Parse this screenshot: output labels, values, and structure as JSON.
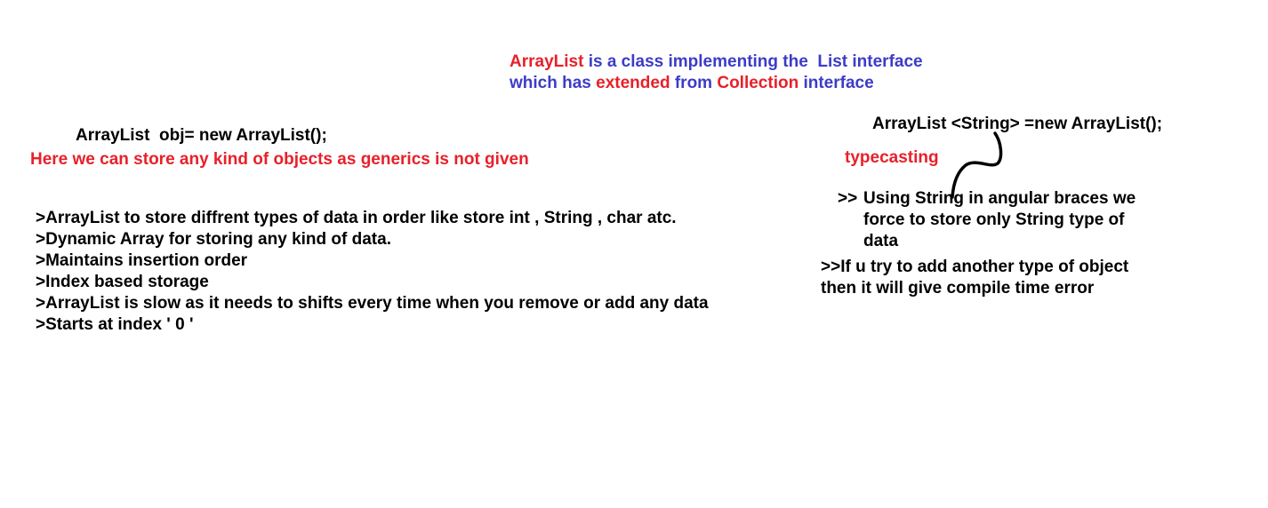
{
  "title": {
    "line1": {
      "w1": "ArrayList",
      "w2": " is a class implementing the  List interface"
    },
    "line2": {
      "w1": "which has ",
      "w2": "extended",
      "w3": " from ",
      "w4": "Collection",
      "w5": " interface"
    }
  },
  "left": {
    "declaration": "ArrayList  obj= new ArrayList();",
    "note": "Here we can store any kind of objects as generics is not given",
    "points": [
      ">ArrayList to store diffrent types of data in order like store int , String , char atc.",
      ">Dynamic Array for storing any kind of data.",
      ">Maintains insertion order",
      ">Index based storage",
      ">ArrayList is slow as it needs to shifts every time when you remove or add any data",
      ">Starts at index ' 0 '"
    ]
  },
  "right": {
    "declaration": "ArrayList <String> =new ArrayList();",
    "typecasting": "typecasting",
    "point1": {
      "marker": ">>",
      "lines": [
        "Using String in angular braces we",
        "force to store only String type of",
        "data"
      ]
    },
    "point2": {
      "lines": [
        ">>If u try to add another type of object",
        "then it will give compile time error"
      ]
    }
  },
  "colors": {
    "red": "#e8202a",
    "blue": "#3c3cc8",
    "text": "#000000"
  }
}
